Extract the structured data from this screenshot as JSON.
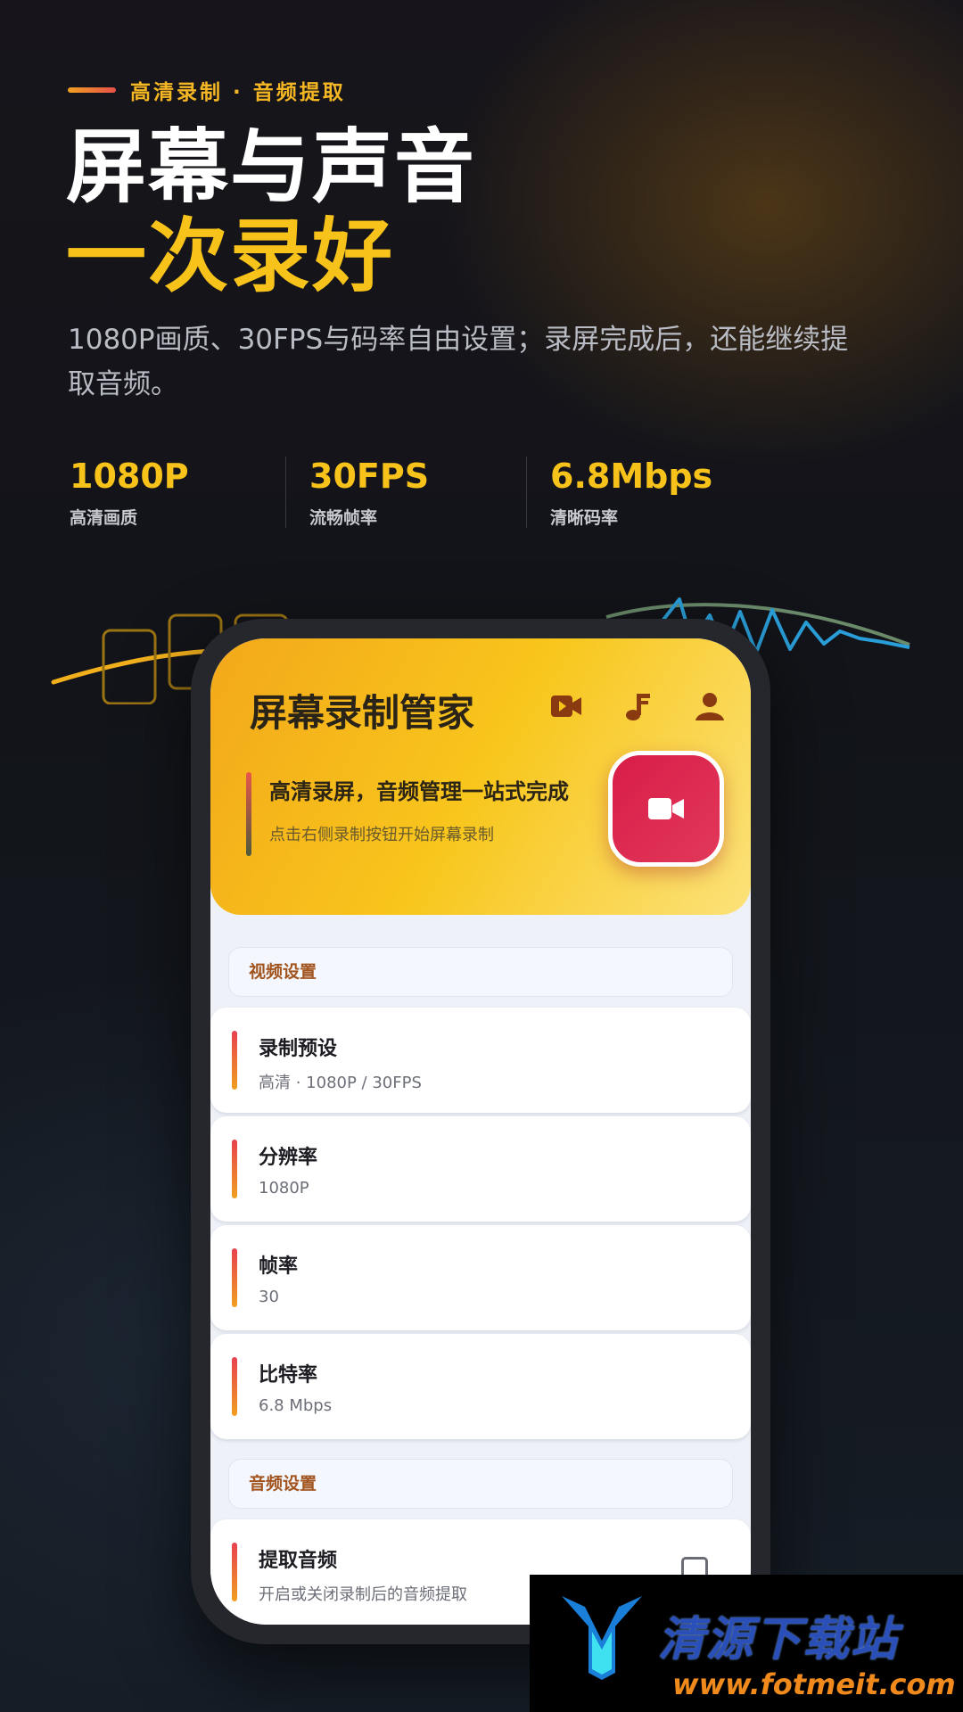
{
  "promo": {
    "tagline": "高清录制 · 音频提取",
    "headline_line1": "屏幕与声音",
    "headline_line2": "一次录好",
    "description": "1080P画质、30FPS与码率自由设置；录屏完成后，还能继续提取音频。",
    "stats": [
      {
        "value": "1080P",
        "label": "高清画质"
      },
      {
        "value": "30FPS",
        "label": "流畅帧率"
      },
      {
        "value": "6.8Mbps",
        "label": "清晰码率"
      }
    ]
  },
  "app": {
    "title": "屏幕录制管家",
    "header_icons": [
      "video-icon",
      "music-note-icon",
      "person-icon"
    ],
    "hero": {
      "title": "高清录屏，音频管理一站式完成",
      "subtitle": "点击右侧录制按钮开始屏幕录制"
    },
    "record_button_icon": "video-camera-icon",
    "video_section": {
      "header": "视频设置",
      "items": [
        {
          "title": "录制预设",
          "value": "高清 · 1080P / 30FPS"
        },
        {
          "title": "分辨率",
          "value": "1080P"
        },
        {
          "title": "帧率",
          "value": "30"
        },
        {
          "title": "比特率",
          "value": "6.8 Mbps"
        }
      ]
    },
    "audio_section": {
      "header": "音频设置",
      "items": [
        {
          "title": "提取音频",
          "value": "开启或关闭录制后的音频提取",
          "checked": false
        }
      ]
    }
  },
  "watermark": {
    "name": "清源下载站",
    "url": "www.fotmeit.com"
  },
  "colors": {
    "accent_yellow": "#f7c21a",
    "record_red": "#d81d48",
    "section_text": "#a2541f"
  }
}
